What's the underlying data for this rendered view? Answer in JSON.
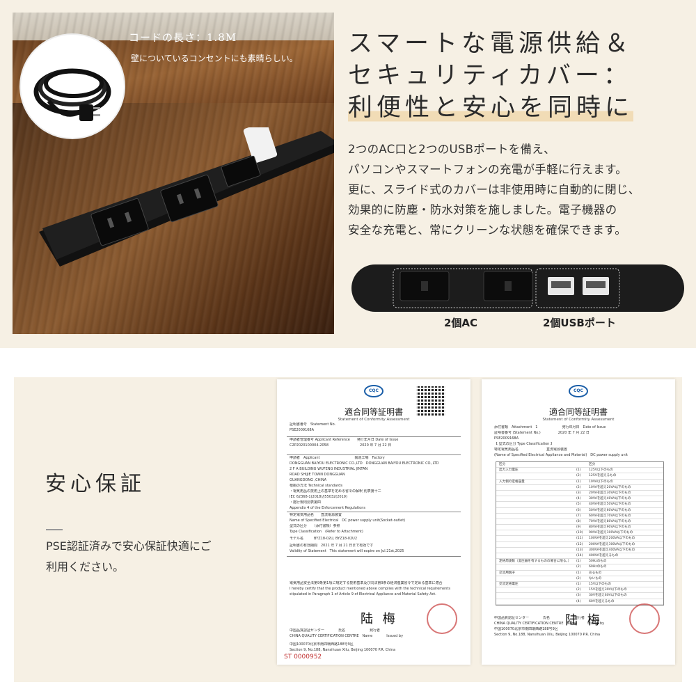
{
  "top": {
    "cord_caption_title": "コードの長さ：1.8M",
    "cord_caption_sub": "壁についているコンセントにも素晴らしい。",
    "heading_lines": [
      "スマートな電源供給＆",
      "セキュリティカバー：",
      "利便性と安心を同時に"
    ],
    "description_lines": [
      "2つのAC口と2つのUSBポートを備え、",
      "パソコンやスマートフォンの充電が手軽に行えます。",
      "更に、スライド式のカバーは非使用時に自動的に閉じ、",
      "効果的に防塵・防水対策を施しました。電子機器の",
      "安全な充電と、常にクリーンな状態を確保できます。"
    ],
    "label_ac": "2個AC",
    "label_usb": "2個USBポート",
    "colors": {
      "background": "#f6f0e4",
      "highlight": "#f1dcb6",
      "strip": "#1c1c1c"
    }
  },
  "bottom": {
    "safety_title": "安心保証",
    "safety_text_lines": [
      "PSE認証済みで安心保証快適にご",
      "利用ください。"
    ]
  },
  "cert1": {
    "logo": "CQC",
    "title": "適合同等証明書",
    "title_en": "Statement of Conformity Assessment",
    "rows": [
      "証明書番号　Statement No.",
      "PSE2009168A",
      "申請者管理番号 Applicant Reference　　発行年月日 Date of Issue",
      "C2P2020100004-2058　　　　　　　　　2020 年 7 月 22 日",
      "申請者　Applicant　　　　　　　　　　製造工場　Factory",
      "DONGGUAN BAIYOU ELECTRONIC CO.,LTD　DONGGUAN BAIYOU ELECTRONIC CO.,LTD",
      "2 F A BUILDING WUFENG INDUSTRIAL JINTAN",
      "ROAD SHIJIE TOWN DONGGUAN",
      "GUANGDONG ,CHINA",
      "根拠の方法 Technical standards",
      "・電気用品の技術上の基準を定める省令の解釈 別表第十二",
      "IEC 62368-1(2018)/J55032(2019)",
      "・施行規則別表第四",
      "Appendix 4 of the Enforcement Regulations",
      "特定電気用品名　　直流電源装置",
      "Name of Specified Electrical　DC power supply unit(Socket-outlet)",
      "型式の区分　　（添付書類）参照",
      "Type Classification　(Refer to Attachment)",
      "モデル名　　　BYZ18-02U, BYZ18-02U2",
      "証明書の有効期間　2021 年 7 月 21 日まで有効です",
      "Validity of Statement　This statement will expire on Jul.21st,2025",
      "電気用品安全法第9条第1項に規定する技術基準及び同法第9条の経済産業省令で定める基準に適合",
      "I hereby certify that the product mentioned above complies with the technical requirements",
      "stipulated in Paragraph 1 of Article 9 of Electrical Appliance and Material Safety Act.",
      "中国品質認証センター　　　　氏名　　　　　　　発行者",
      "CHINA QUALITY CERTIFICATION CENTRE　Name　　　　Issued by",
      "中国100070北京市南四環西路188号9区",
      "Section 9, No.188, Nansihuan Xilu, Beijing 100070 P.R. China"
    ],
    "signature": "陆 梅",
    "serial": "ST 0000952"
  },
  "cert2": {
    "logo": "CQC",
    "title": "適合同等証明書",
    "title_en": "Statement of Conformity Assessment",
    "header_rows": [
      "添付書類　Attachment　1　　　　　　　発行年月日　Date of Issue",
      "証明書番号 (Statement No.)　　　　　2020 年 7 月 22 日",
      "PSE2009168A",
      "【 型式の区分 Type Classification 】",
      "特定電気用品名　　　　　　　　直流電源装置",
      "(Name of Specified Electrical Appliance and Material)　DC power supply unit"
    ],
    "table_rows": [
      {
        "k": "区分",
        "n": "",
        "v": "区分"
      },
      {
        "k": "出力入力電圧",
        "n": "(1)",
        "v": "125V以下のもの"
      },
      {
        "k": "",
        "n": "(2)",
        "v": "125Vを超えるもの"
      },
      {
        "k": "入力側の定格容量",
        "n": "(1)",
        "v": "10VA以下のもの"
      },
      {
        "k": "",
        "n": "(2)",
        "v": "10VAを超え20VA以下のもの"
      },
      {
        "k": "",
        "n": "(3)",
        "v": "20VAを超え30VA以下のもの"
      },
      {
        "k": "",
        "n": "(4)",
        "v": "30VAを超え40VA以下のもの"
      },
      {
        "k": "",
        "n": "(5)",
        "v": "40VAを超え50VA以下のもの"
      },
      {
        "k": "",
        "n": "(6)",
        "v": "50VAを超え60VA以下のもの"
      },
      {
        "k": "",
        "n": "(7)",
        "v": "60VAを超え70VA以下のもの"
      },
      {
        "k": "",
        "n": "(8)",
        "v": "70VAを超え80VA以下のもの"
      },
      {
        "k": "",
        "n": "(9)",
        "v": "80VAを超え90VA以下のもの"
      },
      {
        "k": "",
        "n": "(10)",
        "v": "90VAを超え100VA以下のもの"
      },
      {
        "k": "",
        "n": "(11)",
        "v": "100VAを超え200VA以下のもの"
      },
      {
        "k": "",
        "n": "(12)",
        "v": "200VAを超え300VA以下のもの"
      },
      {
        "k": "",
        "n": "(13)",
        "v": "300VAを超え400VA以下のもの"
      },
      {
        "k": "",
        "n": "(14)",
        "v": "400VAを超えるもの"
      },
      {
        "k": "定格周波数（変圧器を有するものの場合に限る。）",
        "n": "(1)",
        "v": "50Hzのもの"
      },
      {
        "k": "",
        "n": "(2)",
        "v": "60Hzのもの"
      },
      {
        "k": "交流用端子",
        "n": "(1)",
        "v": "あるもの"
      },
      {
        "k": "",
        "n": "(2)",
        "v": "ないもの"
      },
      {
        "k": "交流定格電圧",
        "n": "(1)",
        "v": "15V以下のもの"
      },
      {
        "k": "",
        "n": "(2)",
        "v": "15Vを超え30V以下のもの"
      },
      {
        "k": "",
        "n": "(3)",
        "v": "30Vを超え60V以下のもの"
      },
      {
        "k": "",
        "n": "(4)",
        "v": "60Vを超えるもの"
      }
    ],
    "footer_rows": [
      "中国品質認証センター　　　　氏名　　　　　　　発行者",
      "CHINA QUALITY CERTIFICATION CENTRE　Name　　　Issued by",
      "中国100070北京市南四環西路188号9区",
      "Section 9, No.188, Nansihuan Xilu, Beijing 100070 P.R. China"
    ],
    "signature": "陆 梅"
  }
}
